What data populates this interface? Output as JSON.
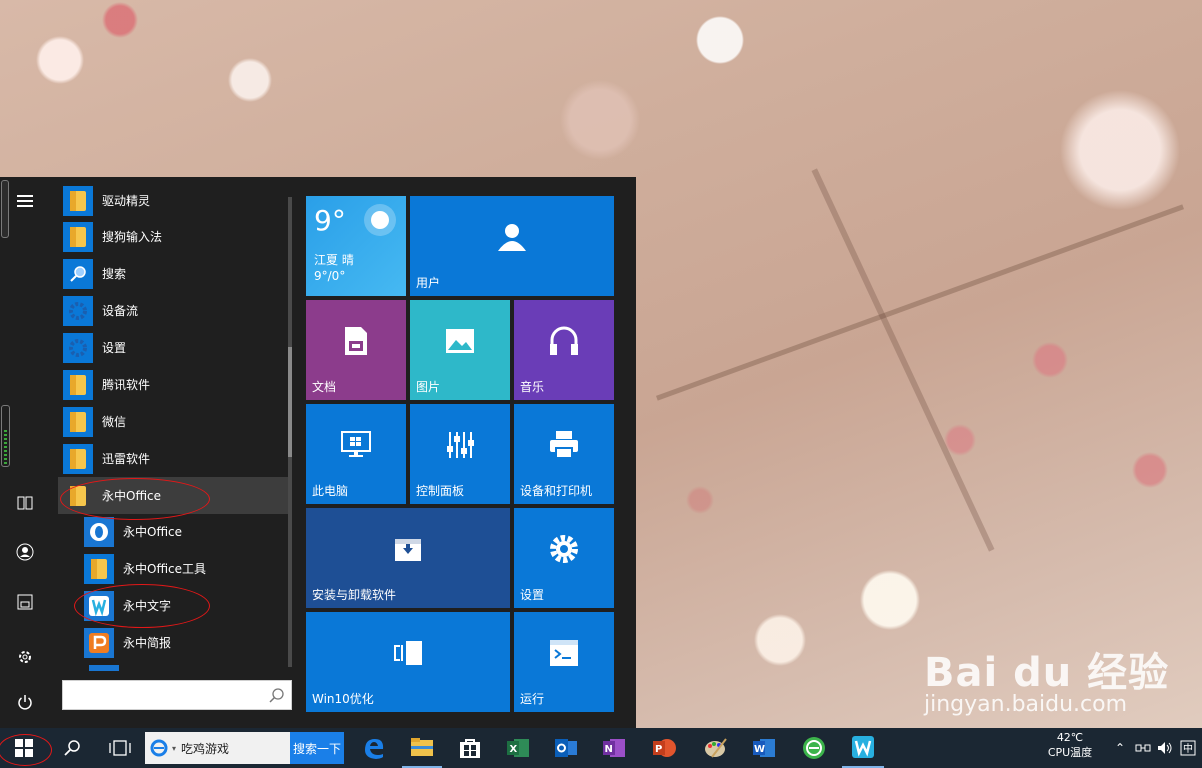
{
  "start_menu": {
    "apps": [
      {
        "label": "驱动精灵",
        "icon": "folder-icon"
      },
      {
        "label": "搜狗输入法",
        "icon": "folder-icon"
      },
      {
        "label": "搜索",
        "icon": "search-icon"
      },
      {
        "label": "设备流",
        "icon": "gear-icon"
      },
      {
        "label": "设置",
        "icon": "gear-icon"
      },
      {
        "label": "腾讯软件",
        "icon": "folder-icon"
      },
      {
        "label": "微信",
        "icon": "folder-icon"
      },
      {
        "label": "迅雷软件",
        "icon": "folder-icon"
      },
      {
        "label": "永中Office",
        "icon": "folder-icon"
      },
      {
        "label": "永中Office",
        "icon": "yozo-office-icon"
      },
      {
        "label": "永中Office工具",
        "icon": "folder-icon"
      },
      {
        "label": "永中文字",
        "icon": "yozo-writer-icon"
      },
      {
        "label": "永中简报",
        "icon": "yozo-presentation-icon"
      }
    ],
    "search_placeholder": "",
    "weather": {
      "temp": "9°",
      "location": "江夏",
      "condition": "晴",
      "range": "9°/0°"
    },
    "tiles": {
      "user": "用户",
      "documents": "文档",
      "pictures": "图片",
      "music": "音乐",
      "this_pc": "此电脑",
      "control_panel": "控制面板",
      "devices_printers": "设备和打印机",
      "install_uninstall": "安装与卸载软件",
      "settings": "设置",
      "win10_optimize": "Win10优化",
      "run": "运行"
    },
    "colors": {
      "blue": "#0a78d7",
      "purple": "#8c3c8c",
      "teal": "#2eb8c9",
      "violet": "#6a3db7",
      "navy": "#1e4f95"
    }
  },
  "taskbar": {
    "search_text": "吃鸡游戏",
    "search_button": "搜索一下",
    "apps": [
      "edge-icon",
      "file-explorer-icon",
      "store-icon",
      "excel-icon",
      "outlook-icon",
      "onenote-icon",
      "powerpoint-icon",
      "paint-icon",
      "word-icon",
      "browser-icon",
      "yozo-writer-icon"
    ],
    "cpu_temp": "42℃",
    "cpu_label": "CPU温度"
  },
  "watermark": {
    "brand": "Bai du 经验",
    "url": "jingyan.baidu.com"
  }
}
